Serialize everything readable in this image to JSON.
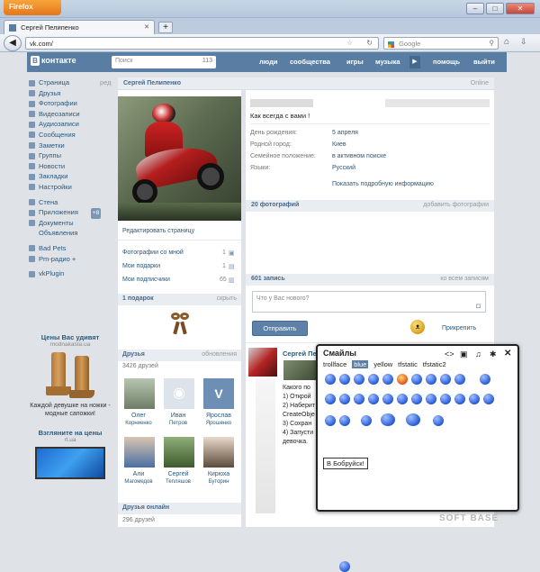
{
  "browser": {
    "app_button": "Firefox",
    "tab_title": "Сергей Пелипенко",
    "new_tab": "+",
    "url": "vk.com/",
    "search_placeholder": "Google",
    "win_min": "–",
    "win_max": "□",
    "win_close": "✕"
  },
  "vk": {
    "logo": "контакте",
    "logo_letter": "В",
    "search_placeholder": "Поиск",
    "search_count": "113",
    "nav": [
      "люди",
      "сообщества",
      "игры",
      "музыка",
      "помощь",
      "выйти"
    ],
    "play": "▶"
  },
  "menu": {
    "items": [
      "Страница",
      "Друзья",
      "Фотографии",
      "Видеозаписи",
      "Аудиозаписи",
      "Сообщения",
      "Заметки",
      "Группы",
      "Новости",
      "Закладки",
      "Настройки"
    ],
    "edit": "ред",
    "items2": [
      "Стена",
      "Приложения",
      "Документы",
      "Объявления"
    ],
    "apps_badge": "+8",
    "items3": [
      "Bad Pets",
      "Pm-радио +"
    ],
    "items4": [
      "vkPlugin"
    ]
  },
  "ads": [
    {
      "title": "Цены Вас удивят",
      "site": "modnakasta.ua",
      "text": "Каждой девушке на ножки - модные сапожки!"
    },
    {
      "title": "Взгляните на цены",
      "site": "rt.ua",
      "text": ""
    }
  ],
  "profile": {
    "header_name": "Сергей Пелипенко",
    "online": "Online",
    "edit_page": "Редактировать страницу",
    "photos_with_me": "Фотографии со мной",
    "photos_count": "1",
    "my_gifts": "Мои подарки",
    "gifts_count": "1",
    "my_subscribers": "Мои подписчики",
    "subscribers_count": "65",
    "gifts_bar": "1 подарок",
    "gifts_hide": "скрыть",
    "friends_bar": "Друзья",
    "friends_updates": "обновления",
    "friends_count": "3426 друзей",
    "friends": [
      {
        "first": "Олег",
        "last": "Корниенко"
      },
      {
        "first": "Иван",
        "last": "Петров"
      },
      {
        "first": "Ярослав",
        "last": "Ярошенко"
      },
      {
        "first": "Али",
        "last": "Магомедов"
      },
      {
        "first": "Сергей",
        "last": "Тепляшов"
      },
      {
        "first": "Кирюха",
        "last": "Буторин"
      }
    ],
    "online_bar": "Друзья онлайн",
    "online_count": "296 друзей"
  },
  "main": {
    "status": "Как всегда с вами !",
    "info": [
      {
        "label": "День рождения:",
        "value": "5 апреля"
      },
      {
        "label": "Родной город:",
        "value": "Киев"
      },
      {
        "label": "Семейное положение:",
        "value": "в активном поиске"
      },
      {
        "label": "Языки:",
        "value": "Русский"
      }
    ],
    "show_more": "Показать подробную информацию",
    "photos_bar": "20 фотографий",
    "add_photos": "добавить фотографии",
    "wall_count": "601 запись",
    "all_posts": "ко всем записям",
    "post_placeholder": "Что у Вас нового?",
    "send": "Отправить",
    "attach": "Прикрепить",
    "post_author": "Сергей Пе",
    "post_lines": [
      "Какого по",
      "1) Открой",
      "2) Наберит",
      "CreateObje",
      "3) Сохран",
      "4) Запусти",
      "девочка."
    ]
  },
  "smiles": {
    "title": "Смайлы",
    "tabs": [
      "trollface",
      "blue",
      "yellow",
      "tfstatic",
      "tfstatic2"
    ],
    "selected": "blue",
    "tooltip": "В Бобруйск!"
  },
  "watermark": "SOFT BASE"
}
